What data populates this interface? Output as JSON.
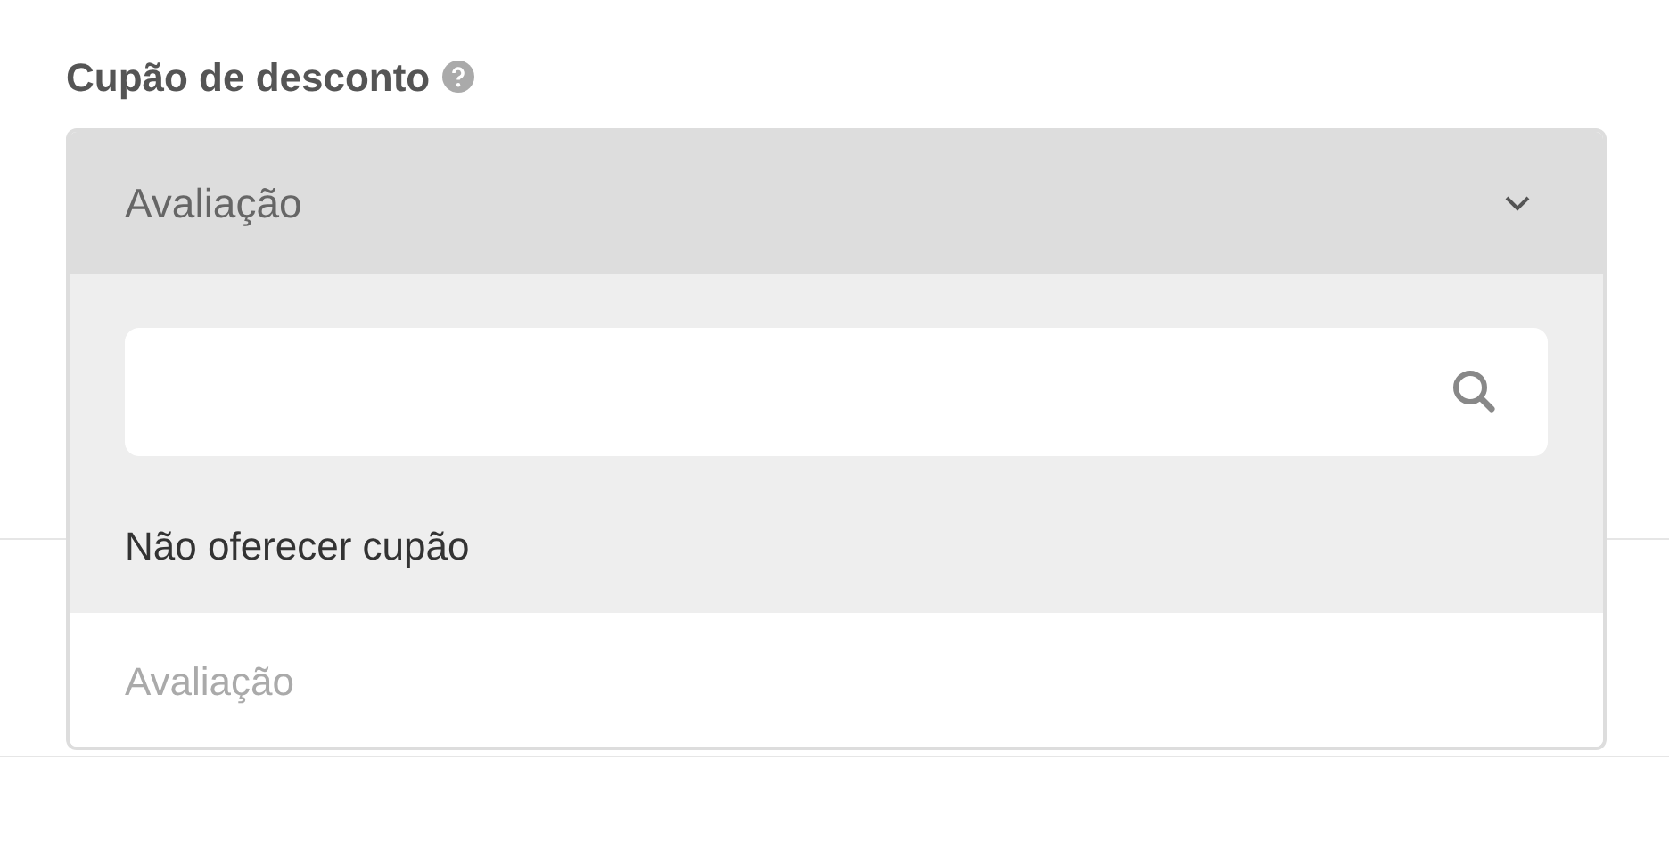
{
  "field": {
    "label": "Cupão de desconto",
    "help": true
  },
  "select": {
    "value": "Avaliação",
    "expanded": true,
    "options": [
      {
        "label": "Não oferecer cupão",
        "highlighted": true,
        "selected": false
      },
      {
        "label": "Avaliação",
        "highlighted": false,
        "selected": true
      }
    ]
  }
}
